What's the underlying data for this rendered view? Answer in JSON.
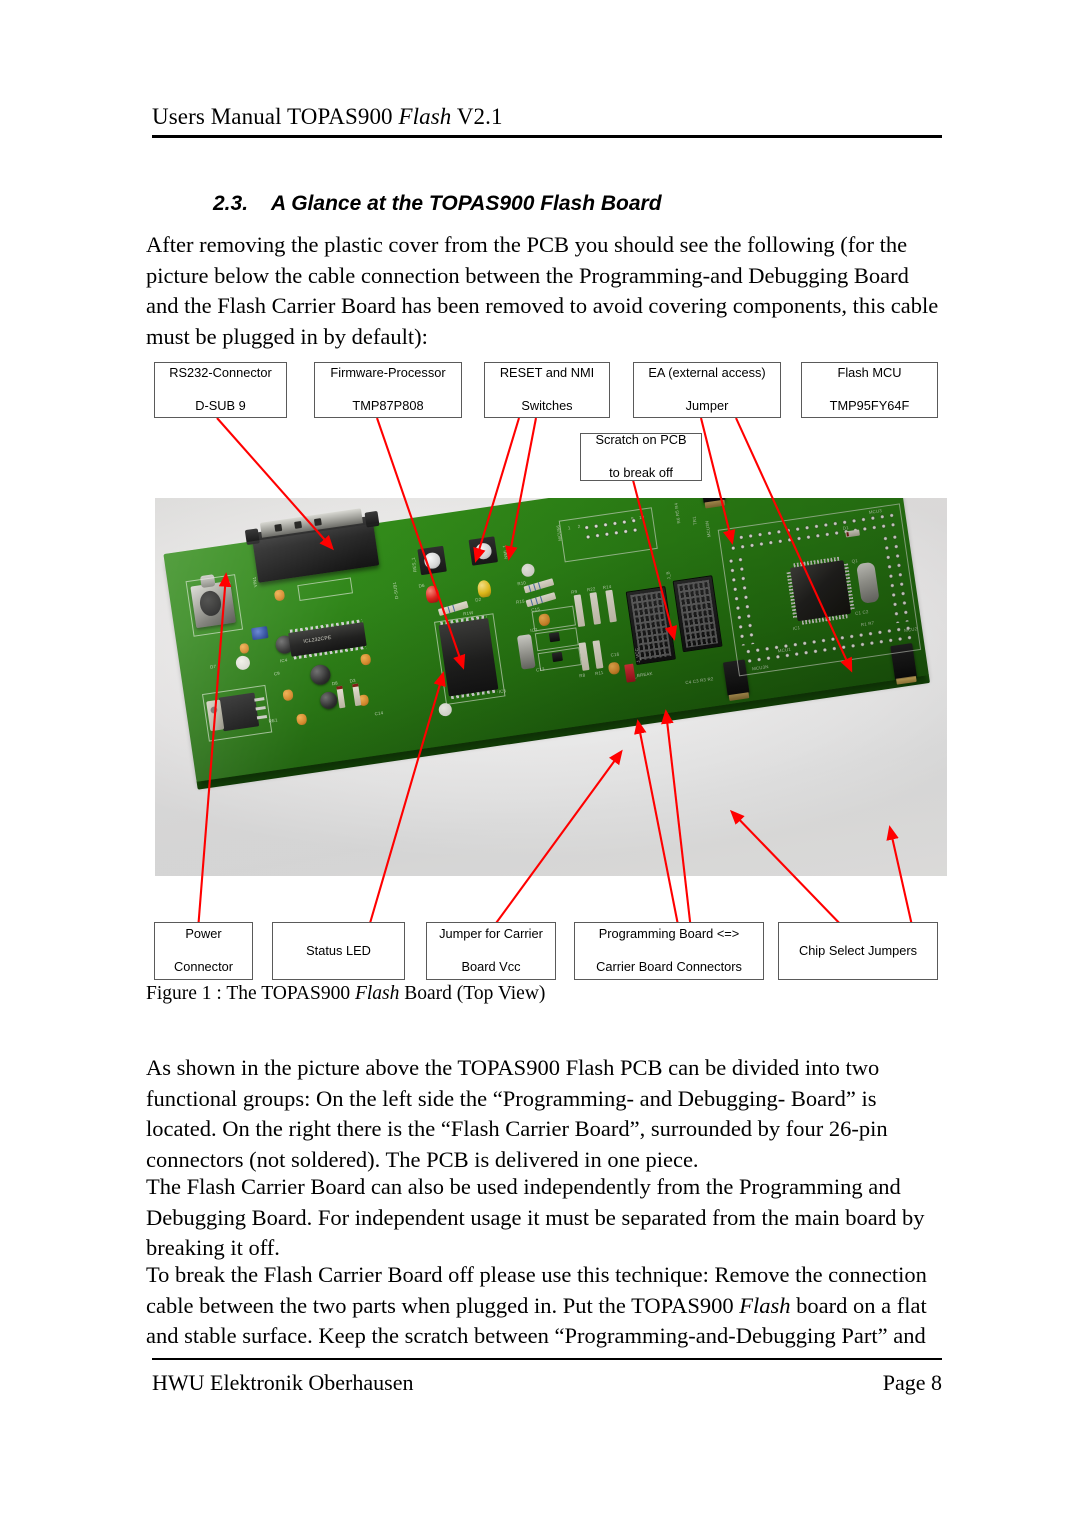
{
  "header": {
    "prefix": "Users Manual TOPAS900 ",
    "italic": "Flash",
    "suffix": " V2.1"
  },
  "section": {
    "number": "2.3.",
    "title": "A Glance at the TOPAS900 Flash Board"
  },
  "paragraphs": {
    "intro_a": "After removing the plastic cover from the PCB you should see the following (for the picture below the cable connection between the Programming-and Debugging Board and the Flash Carrier Board has been removed to avoid covering components, this cable must be plugged in by default):",
    "groups": "As shown in the picture above the TOPAS900 Flash PCB can be divided into two functional groups: On the left side the “Programming- and Debugging- Board” is located. On the right there is the “Flash Carrier Board”, surrounded by four 26-pin connectors (not soldered). The PCB is delivered in one piece.",
    "independent": "The Flash Carrier Board can also be used independently from the Programming and Debugging Board. For independent usage it must be separated from the main board by breaking it off.",
    "break_a": "To break the Flash Carrier Board off please use this technique: Remove the connection cable between the two parts when plugged in. Put the TOPAS900 ",
    "break_italic": "Flash",
    "break_b": " board on a flat and stable surface. Keep the scratch between “Programming-and-Debugging Part” and"
  },
  "figure": {
    "caption_a": "Figure 1 : The TOPAS900 ",
    "caption_italic": "Flash",
    "caption_b": " Board (Top View)",
    "arrow_color": "#ff0000",
    "top_callouts": [
      {
        "line1": "RS232-Connector",
        "line2": "D-SUB 9"
      },
      {
        "line1": "Firmware-Processor",
        "line2": "TMP87P808"
      },
      {
        "line1": "RESET and NMI",
        "line2": "Switches"
      },
      {
        "line1": "EA (external access)",
        "line2": "Jumper"
      },
      {
        "line1": "Flash MCU",
        "line2": "TMP95FY64F"
      }
    ],
    "scratch_callout": {
      "line1": "Scratch on PCB",
      "line2": "to break off"
    },
    "bottom_callouts": [
      {
        "line1": "Power",
        "line2": "Connector"
      },
      {
        "line1": "Status LED",
        "line2": ""
      },
      {
        "line1": "Jumper for Carrier",
        "line2": "Board Vcc"
      },
      {
        "line1": "Programming Board <=>",
        "line2": "Carrier Board Connectors"
      },
      {
        "line1": "Chip Select Jumpers",
        "line2": ""
      }
    ],
    "pcb_silkscreen": [
      "D-SUB1",
      "RES_1",
      "NMI_1",
      "MCU56",
      "MCU3",
      "MCU2",
      "MCU1",
      "IC4",
      "IC5",
      "IC1",
      "IC2",
      "IC3",
      "C5",
      "C8",
      "C9",
      "C10",
      "C12",
      "C13",
      "C14",
      "C15",
      "C16",
      "C21",
      "C22",
      "R8",
      "R9",
      "R10",
      "R11",
      "R14",
      "R15",
      "R22",
      "D1",
      "D2",
      "D3",
      "D6",
      "D7",
      "D8",
      "RE1",
      "J_VCC",
      "J_BREAK",
      "ICL232CPE",
      "1",
      "2",
      "9",
      "10"
    ]
  },
  "footer": {
    "left": "HWU Elektronik Oberhausen",
    "right": "Page 8"
  }
}
